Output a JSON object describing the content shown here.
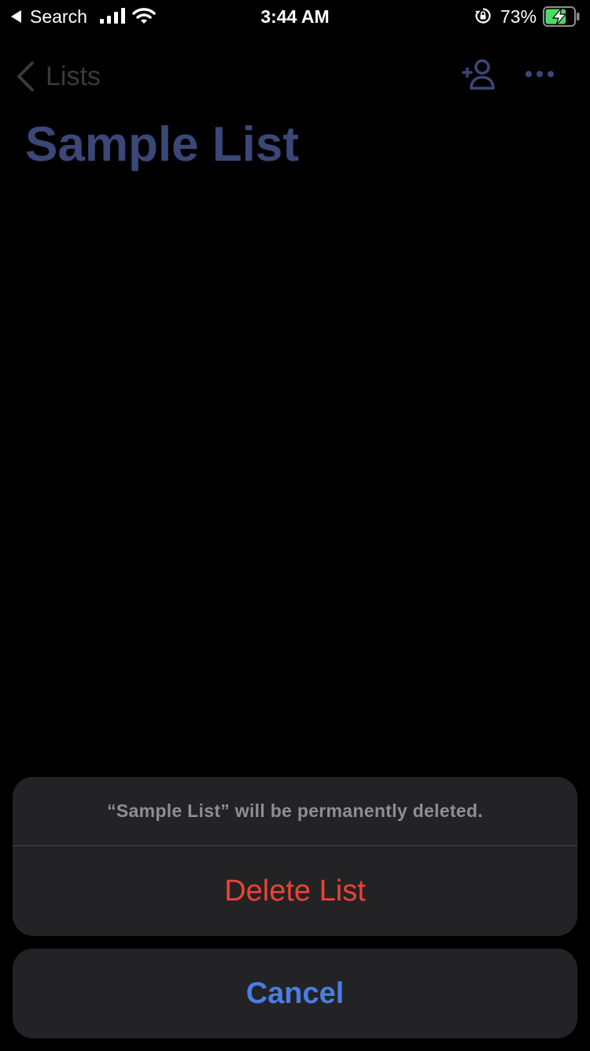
{
  "status_bar": {
    "back_label": "Search",
    "time": "3:44 AM",
    "battery_percent": "73%",
    "battery_level": 0.73,
    "charging": true,
    "icons": [
      "back-arrow-icon",
      "signal-icon",
      "wifi-icon",
      "orientation-lock-icon",
      "battery-charging-icon"
    ]
  },
  "nav": {
    "back_label": "Lists",
    "back_icon": "chevron-left-icon",
    "add_icon": "add-person-icon",
    "more_icon": "more-icon"
  },
  "page": {
    "title": "Sample List"
  },
  "action_sheet": {
    "message": "“Sample List” will be permanently deleted.",
    "delete_label": "Delete List",
    "cancel_label": "Cancel"
  },
  "colors": {
    "background": "#000000",
    "dimmed_accent": "#3b4776",
    "destructive": "#eb4335",
    "accent": "#4a7de6",
    "sheet_background": "#232325",
    "battery_fill": "#4cd964"
  }
}
